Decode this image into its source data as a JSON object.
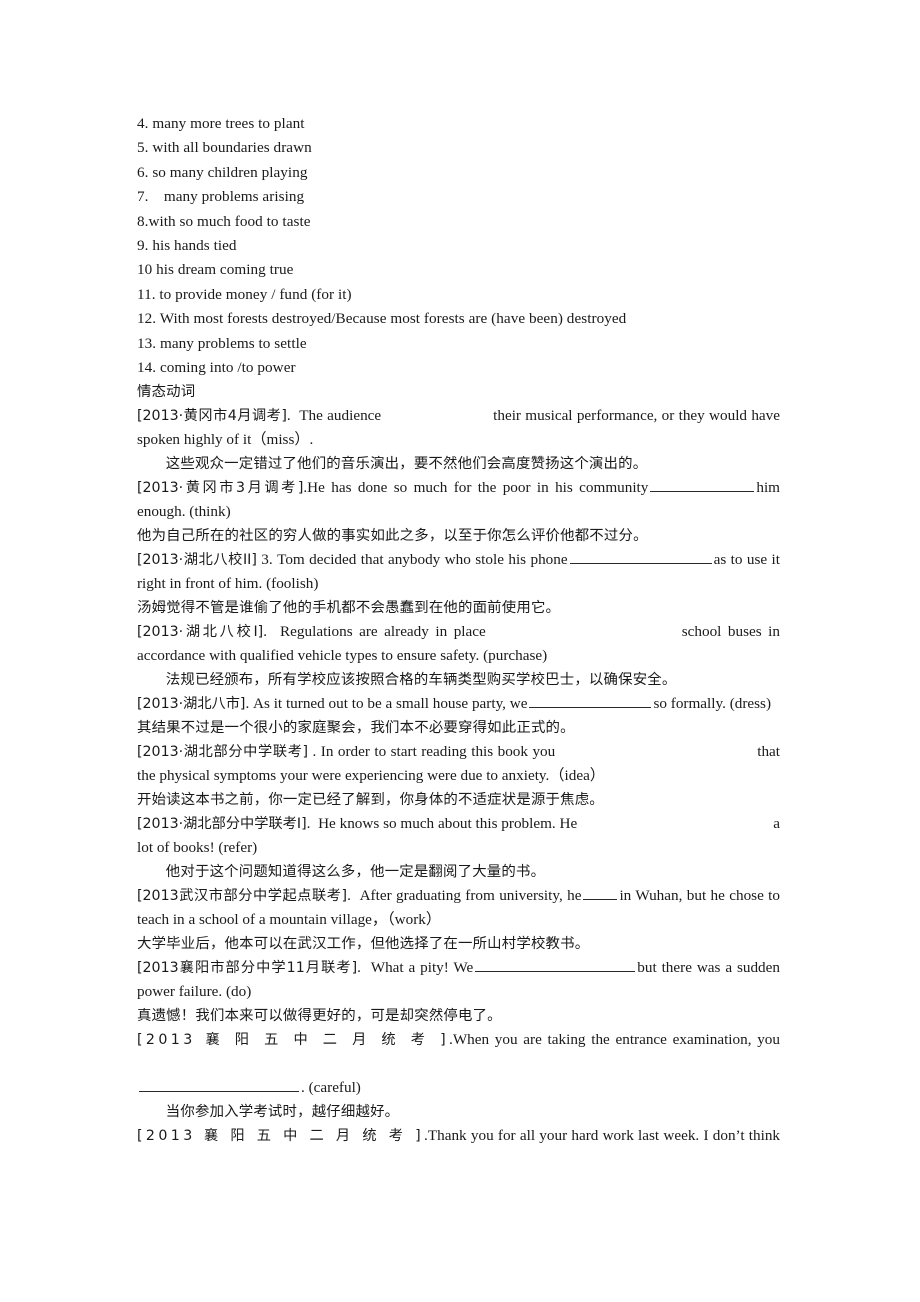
{
  "document": {
    "answers_heading": "",
    "answer_list": [
      "4. many more trees to plant",
      "5. with all boundaries drawn",
      "6. so many children playing",
      "7.    many problems arising",
      "8.with so much food to taste",
      "9. his hands tied",
      "10 his dream coming true",
      "11. to provide money / fund (for it)",
      "12. With most forests destroyed/Because most forests are (have been) destroyed",
      "13. many problems to settle",
      "14. coming into /to power"
    ],
    "section_heading": "情态动词",
    "items": [
      {
        "tag": "[2013·黄冈市4月调考]",
        "en_before": ".  The audience",
        "en_after": "their musical performance, or they would have spoken highly of it（miss）.",
        "zh": "这些观众一定错过了他们的音乐演出，要不然他们会高度赞扬这个演出的。",
        "hint": "miss"
      },
      {
        "tag": "[2013·黄冈市3月调考]",
        "en_before": ".He has done so much for the poor in his community",
        "en_after": "him enough. (think)",
        "zh": "他为自己所在的社区的穷人做的事实如此之多，以至于你怎么评价他都不过分。",
        "hint": "think"
      },
      {
        "tag": "[2013·湖北八校II]",
        "en_before": " 3. Tom decided that anybody who stole his phone",
        "en_after": "as to use it right in front of him. (foolish)",
        "zh": "汤姆觉得不管是谁偷了他的手机都不会愚蠢到在他的面前使用它。",
        "hint": "foolish"
      },
      {
        "tag": "[2013·湖北八校I]",
        "en_before": ".  Regulations are already in place",
        "en_after": "school buses in accordance with qualified vehicle types to ensure safety. (purchase)",
        "zh": "法规已经颁布，所有学校应该按照合格的车辆类型购买学校巴士，以确保安全。",
        "hint": "purchase"
      },
      {
        "tag": "[2013·湖北八市]",
        "en_before": ". As it turned out to be a small house party, we",
        "en_after": "so formally. (dress)",
        "zh": "其结果不过是一个很小的家庭聚会，我们本不必要穿得如此正式的。",
        "hint": "dress"
      },
      {
        "tag": "[2013·湖北部分中学联考]",
        "en_before": " . In order to start reading this book you",
        "en_after": "that the physical symptoms your were experiencing were due to anxiety.（idea）",
        "zh": "开始读这本书之前，你一定已经了解到，你身体的不适症状是源于焦虑。",
        "hint": "idea"
      },
      {
        "tag": "[2013·湖北部分中学联考I]",
        "en_before": ".  He knows so much about this problem. He",
        "en_after": "a lot of books! (refer)",
        "zh": "他对于这个问题知道得这么多，他一定是翻阅了大量的书。",
        "hint": "refer"
      },
      {
        "tag": "[2013武汉市部分中学起点联考]",
        "en_before": ".  After graduating from university, he",
        "en_after": "in Wuhan, but he chose to teach in a school of a mountain village，（work）",
        "zh": "大学毕业后，他本可以在武汉工作，但他选择了在一所山村学校教书。",
        "hint": "work"
      },
      {
        "tag": "[2013襄阳市部分中学11月联考]",
        "en_before": ".  What a pity! We",
        "en_after": "but there was a sudden power failure. (do)",
        "zh": "真遗憾！我们本来可以做得更好的，可是却突然停电了。",
        "hint": "do"
      },
      {
        "tag": "[2013 襄 阳 五 中 二 月 统 考 ]",
        "en_before": ".When you are taking the entrance examination, you",
        "en_after": ". (careful)",
        "zh": "当你参加入学考试时，越仔细越好。",
        "hint": "careful"
      },
      {
        "tag": "[2013 襄 阳 五 中 二 月 统 考 ]",
        "en_before": ".Thank you for all your hard work last week. I don’t think",
        "en_after": "",
        "zh": "",
        "hint": ""
      }
    ]
  }
}
